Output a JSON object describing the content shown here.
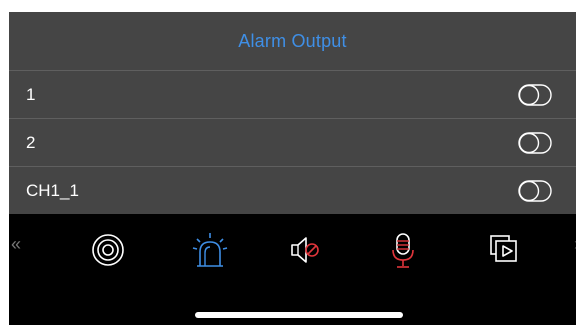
{
  "panel": {
    "title": "Alarm Output"
  },
  "outputs": [
    {
      "label": "1",
      "state": "off"
    },
    {
      "label": "2",
      "state": "off"
    },
    {
      "label": "CH1_1",
      "state": "off"
    }
  ],
  "toolbar": {
    "left_arrow": "«",
    "right_arrow": "›",
    "icons": [
      "snapshot-icon",
      "alarm-light-icon",
      "speaker-muted-icon",
      "microphone-icon",
      "playback-icon"
    ]
  },
  "colors": {
    "accent": "#3f8fe6",
    "alert_red": "#e0353b",
    "panel_bg": "#454545"
  }
}
